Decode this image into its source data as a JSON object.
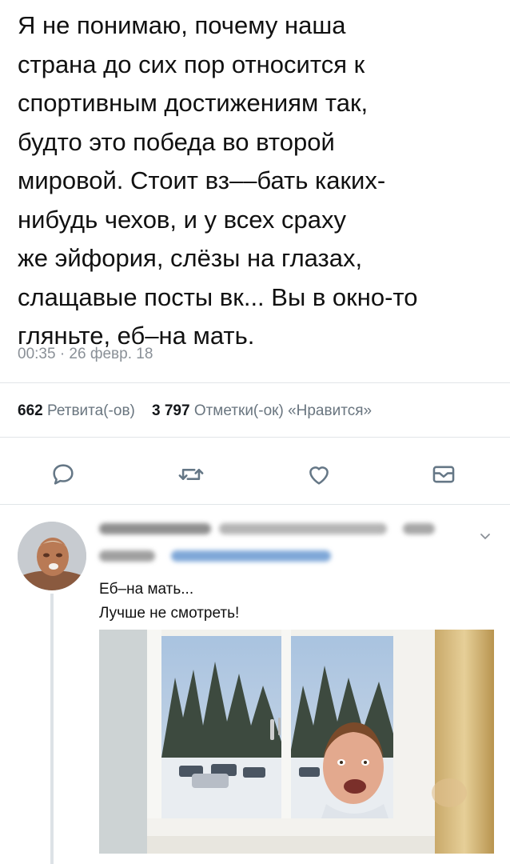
{
  "tweet": {
    "lines": [
      "Я не понимаю, почему наша",
      "страна до сих пор относится к",
      "спортивным достижениям так,",
      "будто это победа во второй",
      "мировой. Стоит вз‒‒бать каких-",
      "нибудь чехов, и у всех сраху",
      "же эйфория, слёзы на глазах,",
      "слащавые посты вк... Вы в окно-то",
      "гляньте, еб‒на мать."
    ],
    "timestamp": "00:35 · 26 февр. 18"
  },
  "stats": {
    "retweets_count": "662",
    "retweets_label": "Ретвита(-ов)",
    "likes_count": "3 797",
    "likes_label": "Отметки(-ок) «Нравится»"
  },
  "actions": {
    "icons": [
      "reply-icon",
      "retweet-icon",
      "like-icon",
      "message-icon"
    ]
  },
  "reply": {
    "text_line1": "Еб‒на мать...",
    "text_line2": "Лучше не смотреть!"
  },
  "colors": {
    "text": "#111111",
    "secondary": "#8a9097",
    "divider": "#e1e5e8",
    "icon": "#657786"
  }
}
